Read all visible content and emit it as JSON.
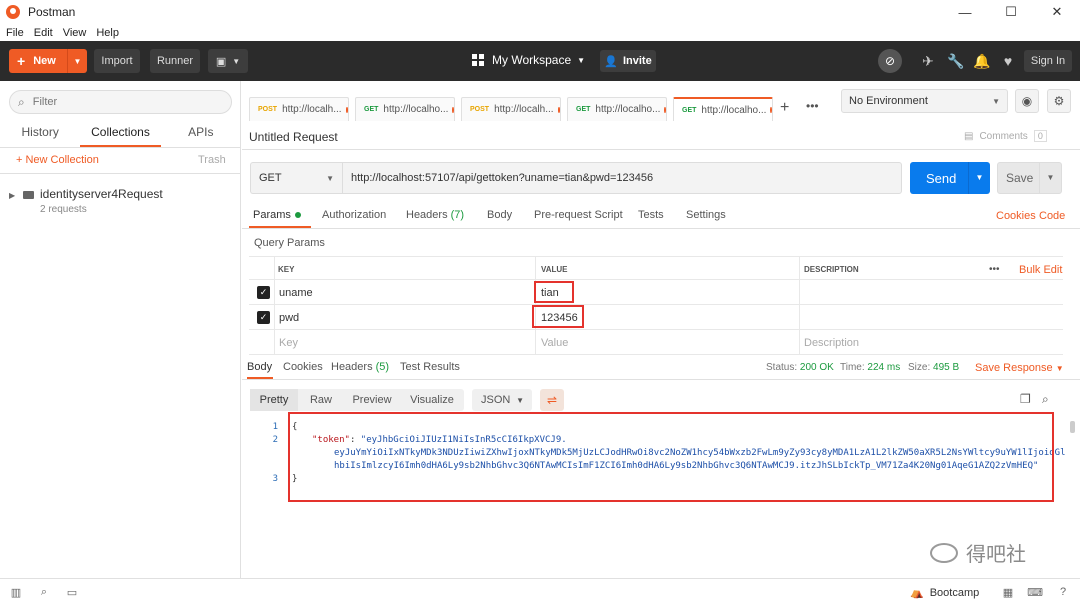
{
  "window": {
    "title": "Postman",
    "controls": [
      "—",
      "☐",
      "✕"
    ]
  },
  "menu": [
    "File",
    "Edit",
    "View",
    "Help"
  ],
  "toolbar": {
    "new_label": "New",
    "import_label": "Import",
    "runner_label": "Runner",
    "workspace_label": "My Workspace",
    "invite_label": "Invite",
    "signin_label": "Sign In"
  },
  "sidebar": {
    "filter_placeholder": "Filter",
    "tabs": [
      "History",
      "Collections",
      "APIs"
    ],
    "active_tab": "Collections",
    "new_collection_label": "+ New Collection",
    "trash_label": "Trash",
    "collections": [
      {
        "name": "identityserver4Request",
        "count": "2 requests"
      }
    ]
  },
  "request_tabs": [
    {
      "method": "POST",
      "label": "http://localh..."
    },
    {
      "method": "GET",
      "label": "http://localho..."
    },
    {
      "method": "POST",
      "label": "http://localh..."
    },
    {
      "method": "GET",
      "label": "http://localho..."
    },
    {
      "method": "GET",
      "label": "http://localho..."
    }
  ],
  "environment": {
    "selected": "No Environment"
  },
  "request": {
    "title": "Untitled Request",
    "comments_label": "Comments",
    "comments_count": "0",
    "method": "GET",
    "url": "http://localhost:57107/api/gettoken?uname=tian&pwd=123456",
    "send_label": "Send",
    "save_label": "Save"
  },
  "request_subtabs": {
    "params": "Params",
    "authorization": "Authorization",
    "headers": "Headers",
    "headers_count": "(7)",
    "body": "Body",
    "prerequest": "Pre-request Script",
    "tests": "Tests",
    "settings": "Settings",
    "cookies_link": "Cookies",
    "code_link": "Code"
  },
  "query_params": {
    "label": "Query Params",
    "headers": {
      "key": "KEY",
      "value": "VALUE",
      "description": "DESCRIPTION"
    },
    "more": "•••",
    "bulk_edit": "Bulk Edit",
    "rows": [
      {
        "checked": true,
        "key": "uname",
        "value": "tian"
      },
      {
        "checked": true,
        "key": "pwd",
        "value": "123456"
      }
    ],
    "placeholders": {
      "key": "Key",
      "value": "Value",
      "description": "Description"
    }
  },
  "response": {
    "tabs": {
      "body": "Body",
      "cookies": "Cookies",
      "headers": "Headers",
      "headers_count": "(5)",
      "test_results": "Test Results"
    },
    "status_label": "Status:",
    "status_value": "200 OK",
    "time_label": "Time:",
    "time_value": "224 ms",
    "size_label": "Size:",
    "size_value": "495 B",
    "save_response_label": "Save Response",
    "view_modes": [
      "Pretty",
      "Raw",
      "Preview",
      "Visualize"
    ],
    "active_view": "Pretty",
    "format": "JSON",
    "lines": [
      {
        "num": "1",
        "text": "{"
      },
      {
        "num": "2",
        "key": "\"token\"",
        "sep": ": ",
        "value_lines": [
          "\"eyJhbGciOiJIUzI1NiIsInR5cCI6IkpXVCJ9.",
          "eyJuYmYiOiIxNTkyMDk3NDUzIiwiZXhwIjoxNTkyMDk5MjUzLCJodHRwOi8vc2NoZW1hcy54bWxzb2FwLm9yZy93cy8yMDA1LzA1L2lkZW50aXR5L2NsYWltcy9uYW1lIjoidGl",
          "hbiIsImlzcyI6Imh0dHA6Ly9sb2NhbGhvc3Q6NTAwMCIsImF1ZCI6Imh0dHA6Ly9sb2NhbGhvc3Q6NTAwMCJ9.itzJhSLbIckTp_VM71Za4K20Ng01AqeG1AZQ2zVmHEQ\""
        ]
      },
      {
        "num": "3",
        "text": "}"
      }
    ]
  },
  "footer": {
    "bootcamp_label": "Bootcamp"
  },
  "watermark": "得吧社",
  "colors": {
    "accent": "#ef5b25",
    "send": "#097bed",
    "ok": "#1c9a3f",
    "highlight": "#e4332d"
  }
}
